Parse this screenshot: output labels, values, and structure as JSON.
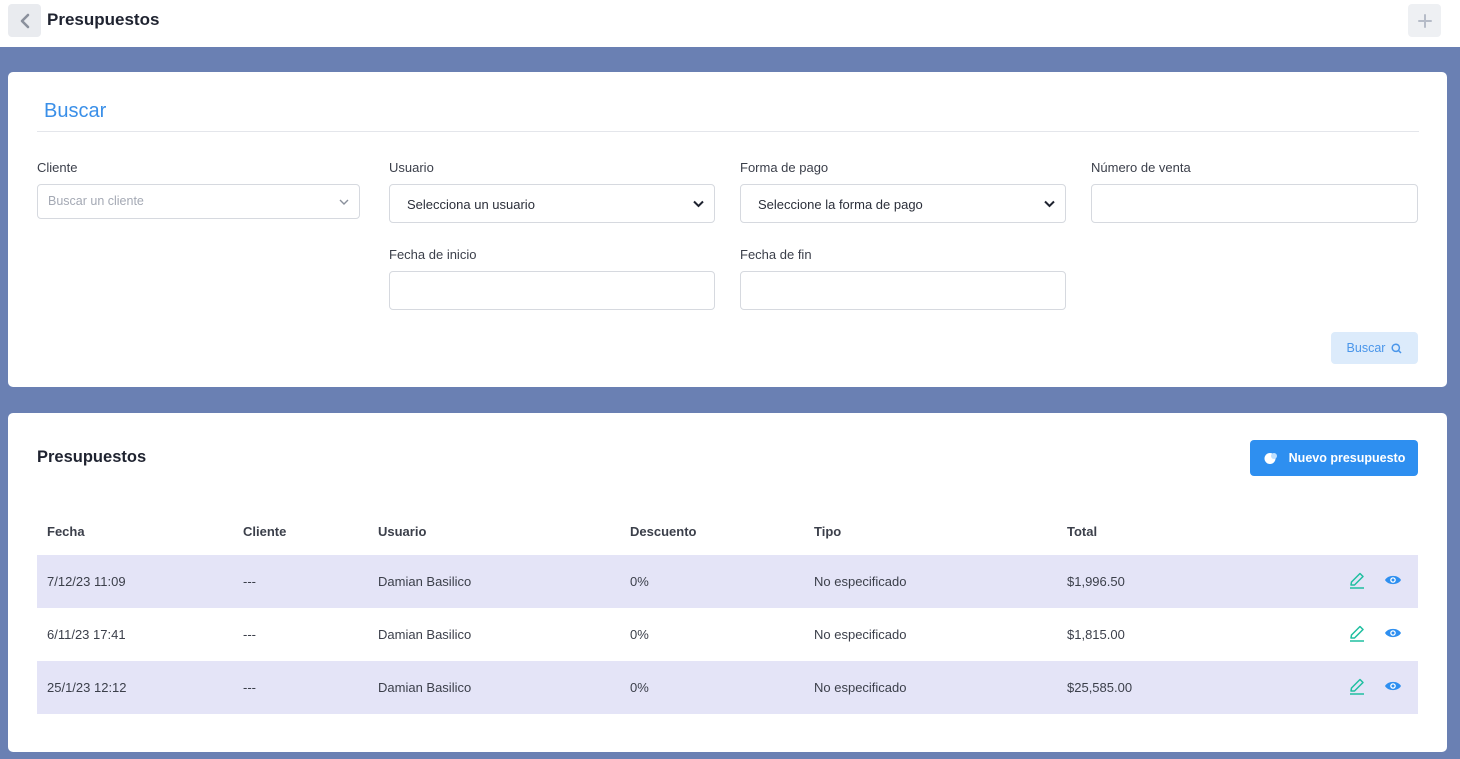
{
  "header": {
    "title": "Presupuestos"
  },
  "search": {
    "title": "Buscar",
    "cliente_label": "Cliente",
    "cliente_placeholder": "Buscar un cliente",
    "usuario_label": "Usuario",
    "usuario_value": "Selecciona un usuario",
    "pago_label": "Forma de pago",
    "pago_value": "Seleccione la forma de pago",
    "venta_label": "Número de venta",
    "inicio_label": "Fecha de inicio",
    "fin_label": "Fecha de fin",
    "button_label": "Buscar"
  },
  "list": {
    "title": "Presupuestos",
    "new_button_label": "Nuevo presupuesto",
    "columns": [
      "Fecha",
      "Cliente",
      "Usuario",
      "Descuento",
      "Tipo",
      "Total"
    ],
    "rows": [
      {
        "fecha": "7/12/23 11:09",
        "cliente": "---",
        "usuario": "Damian Basilico",
        "descuento": "0%",
        "tipo": "No especificado",
        "total": "$1,996.50"
      },
      {
        "fecha": "6/11/23 17:41",
        "cliente": "---",
        "usuario": "Damian Basilico",
        "descuento": "0%",
        "tipo": "No especificado",
        "total": "$1,815.00"
      },
      {
        "fecha": "25/1/23 12:12",
        "cliente": "---",
        "usuario": "Damian Basilico",
        "descuento": "0%",
        "tipo": "No especificado",
        "total": "$25,585.00"
      }
    ]
  },
  "colors": {
    "background": "#6a80b3",
    "accent": "#2e8ff0",
    "row_alt": "#e4e4f7",
    "edit_icon": "#1fbfa0",
    "view_icon": "#2e8ff0"
  }
}
